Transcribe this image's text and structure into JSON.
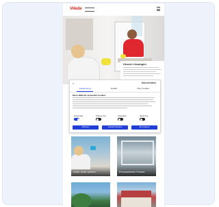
{
  "site": {
    "logo_text": "Vileda",
    "brand_color": "#d9241b"
  },
  "hero": {
    "panel_title": "Unsere Lösungen"
  },
  "cookie_banner": {
    "close_symbol": "×",
    "brand": "Usercentrics",
    "tabs": [
      {
        "label": "Zustimmung",
        "active": true
      },
      {
        "label": "Details",
        "active": false
      },
      {
        "label": "Über Cookies",
        "active": false
      }
    ],
    "heading": "Diese Website verwendet Cookies",
    "toggles": [
      {
        "label": "Notwendig",
        "on": true
      },
      {
        "label": "Präferenzen",
        "on": false
      },
      {
        "label": "Statistiken",
        "on": false
      },
      {
        "label": "Marketing",
        "on": false
      }
    ],
    "buttons": [
      {
        "label": "Ablehnen"
      },
      {
        "label": "Auswahl erlauben"
      },
      {
        "label": "Alle zulassen"
      }
    ],
    "accent_color": "#1f3fd6"
  },
  "tiles": [
    {
      "caption": "Unter male sauber"
    },
    {
      "caption": "Einwandfreie Fenster"
    },
    {
      "caption": ""
    },
    {
      "caption": ""
    }
  ]
}
